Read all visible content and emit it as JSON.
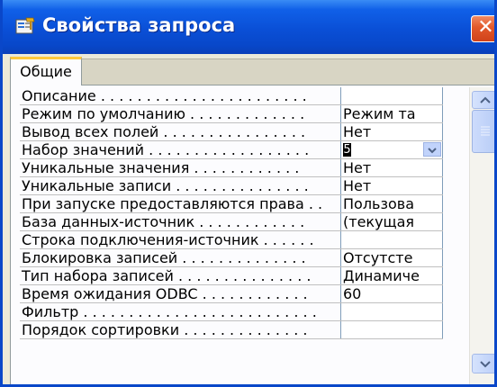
{
  "window": {
    "title": "Свойства запроса"
  },
  "tabs": [
    {
      "label": "Общие"
    }
  ],
  "properties": [
    {
      "label": "Описание . . . . . . . . . . . . . . . . . . . . . . .",
      "value": ""
    },
    {
      "label": "Режим по умолчанию . . . . . . . . . . . . .",
      "value": "Режим та"
    },
    {
      "label": "Вывод всех полей . . . . . . . . . . . . . . . .",
      "value": "Нет"
    },
    {
      "label": "Набор значений . . . . . . . . . . . . . . . . . .",
      "value": "5"
    },
    {
      "label": "Уникальные значения . . . . . . . . . . . .",
      "value": "Нет"
    },
    {
      "label": "Уникальные записи . . . . . . . . . . . . . . .",
      "value": "Нет"
    },
    {
      "label": "При запуске предоставляются права . .",
      "value": "Пользова"
    },
    {
      "label": "База данных-источник . . . . . . . . . . . .",
      "value": "(текущая"
    },
    {
      "label": "Строка подключения-источник . . . . . .",
      "value": ""
    },
    {
      "label": "Блокировка записей . . . . . . . . . . . . . .",
      "value": "Отсутсте"
    },
    {
      "label": "Тип набора записей . . . . . . . . . . . . . . .",
      "value": "Динамиче"
    },
    {
      "label": "Время ожидания ODBC . . . . . . . . . . . .",
      "value": "60"
    },
    {
      "label": "Фильтр . . . . . . . . . . . . . . . . . . . . . . . . . .",
      "value": ""
    },
    {
      "label": "Порядок сортировки . . . . . . . . . . . . . .",
      "value": ""
    }
  ],
  "icons": {
    "window": "properties-sheet-icon",
    "close": "close-icon",
    "dropdown": "chevron-down-icon",
    "scroll_up": "chevron-up-icon",
    "scroll_down": "chevron-down-icon"
  },
  "colors": {
    "titlebar": "#0a4fd6",
    "close_button": "#e2582a",
    "tab_highlight": "#ffc83c",
    "scrollbar_accent": "#b9cdf8"
  }
}
